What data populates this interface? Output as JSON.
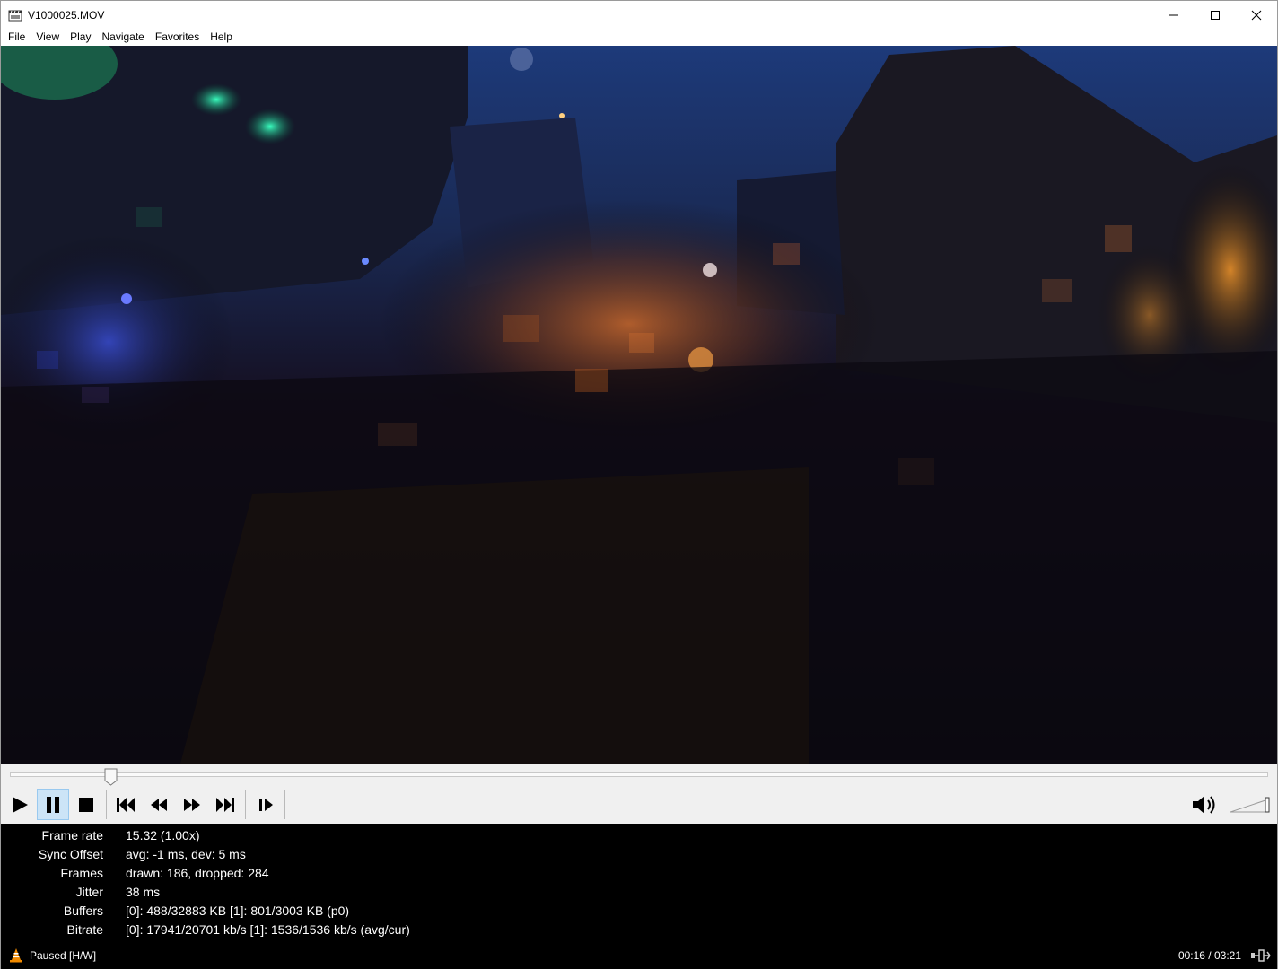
{
  "window": {
    "title": "V1000025.MOV",
    "minimize_icon": "minimize-icon",
    "maximize_icon": "maximize-icon",
    "close_icon": "close-icon"
  },
  "menu": [
    "File",
    "View",
    "Play",
    "Navigate",
    "Favorites",
    "Help"
  ],
  "seek": {
    "position_fraction": 0.08
  },
  "controls": {
    "play_icon": "play-icon",
    "pause_icon": "pause-icon",
    "stop_icon": "stop-icon",
    "prev_icon": "skip-back-icon",
    "rewind_icon": "rewind-icon",
    "forward_icon": "fast-forward-icon",
    "next_icon": "skip-forward-icon",
    "frame_step_icon": "frame-step-icon",
    "volume_icon": "volume-icon",
    "volume_level": 1.0,
    "active_button": "pause"
  },
  "stats": [
    {
      "label": "Frame rate",
      "value": "15.32 (1.00x)"
    },
    {
      "label": "Sync Offset",
      "value": "avg: -1 ms, dev: 5 ms"
    },
    {
      "label": "Frames",
      "value": "drawn: 186, dropped: 284"
    },
    {
      "label": "Jitter",
      "value": "38 ms"
    },
    {
      "label": "Buffers",
      "value": "[0]: 488/32883 KB [1]: 801/3003 KB (p0)"
    },
    {
      "label": "Bitrate",
      "value": "[0]: 17941/20701 kb/s [1]: 1536/1536 kb/s (avg/cur)"
    }
  ],
  "status": {
    "text": "Paused [H/W]",
    "time": "00:16 / 03:21",
    "icon": "vlc-cone-icon"
  },
  "colors": {
    "accent": "#cce4f7",
    "stats_bg": "#000000",
    "controls_bg": "#f0f0f0"
  }
}
